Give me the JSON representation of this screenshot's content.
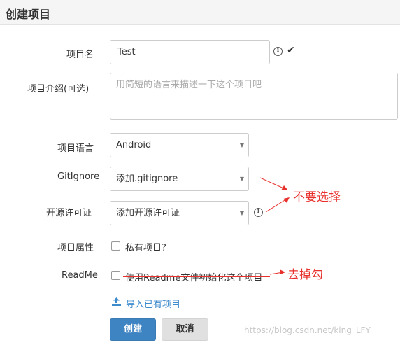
{
  "header": {
    "title": "创建项目"
  },
  "form": {
    "name": {
      "label": "项目名",
      "value": "Test"
    },
    "description": {
      "label": "项目介绍(可选)",
      "placeholder": "用简短的语言来描述一下这个项目吧"
    },
    "language": {
      "label": "项目语言",
      "value": "Android"
    },
    "gitignore": {
      "label": "GitIgnore",
      "value": "添加.gitignore"
    },
    "license": {
      "label": "开源许可证",
      "value": "添加开源许可证"
    },
    "attribute": {
      "label": "项目属性",
      "checkbox_label": "私有项目?"
    },
    "readme": {
      "label": "ReadMe",
      "checkbox_label": "使用Readme文件初始化这个项目"
    },
    "import_link": "导入已有项目",
    "create_button": "创建",
    "cancel_button": "取消"
  },
  "annotations": {
    "no_select": "不要选择",
    "remove_check": "去掉勾",
    "color": "#e8312c"
  },
  "watermark": "https://blog.csdn.net/king_LFY",
  "icons": [
    "info-icon",
    "check-icon",
    "caret-down-icon",
    "upload-icon"
  ]
}
